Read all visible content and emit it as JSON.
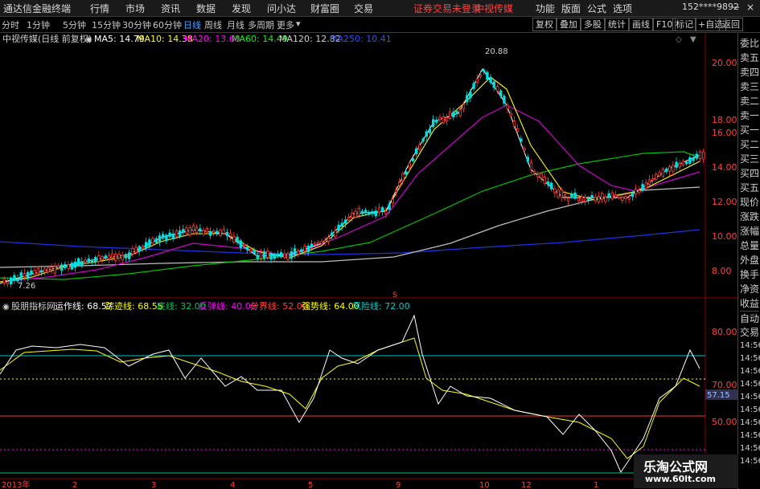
{
  "menu": {
    "app_title": "通达信金融终端",
    "items": [
      "行情",
      "市场",
      "资讯",
      "数据",
      "发现",
      "问小达",
      "财富圈",
      "交易"
    ],
    "notice": "证券交易未登录",
    "stock_name": "中视传媒",
    "right_items": [
      "功能",
      "版面",
      "公式",
      "选项"
    ],
    "account": "152****9892"
  },
  "period_tabs": [
    "分时",
    "1分钟",
    "5分钟",
    "15分钟",
    "30分钟",
    "60分钟",
    "日线",
    "周线",
    "月线",
    "多周期",
    "更多"
  ],
  "active_tab": "日线",
  "toolbar_buttons": [
    "复权",
    "叠加",
    "多股",
    "统计",
    "画线",
    "F10",
    "标记",
    "+自选",
    "返回"
  ],
  "main_chart": {
    "title": "中视传媒(日线 前复权)",
    "ma": [
      {
        "label": "MA5: 14.79",
        "color": "#ffffff"
      },
      {
        "label": "MA10: 14.38",
        "color": "#ffff00"
      },
      {
        "label": "MA20: 13.60",
        "color": "#ff00ff"
      },
      {
        "label": "MA60: 14.49",
        "color": "#00ff00"
      },
      {
        "label": "MA120: 12.82",
        "color": "#c0c0c0"
      },
      {
        "label": "MA250: 10.41",
        "color": "#3050ff"
      }
    ],
    "price_ticks": [
      "20.00",
      "18.00",
      "16.00",
      "14.00",
      "12.00",
      "10.00",
      "8.00"
    ],
    "high_label": "20.88",
    "low_label": "7.26"
  },
  "indicator": {
    "name": "股朋指标网",
    "items": [
      {
        "label": "运作线: 68.57",
        "color": "#ffffff"
      },
      {
        "label": "踪迹线: 68.55",
        "color": "#ffff00"
      },
      {
        "label": "底线: 32.00",
        "color": "#00c060"
      },
      {
        "label": "反弹线: 40.00",
        "color": "#ff00ff"
      },
      {
        "label": "分界线: 52.00",
        "color": "#ff4040"
      },
      {
        "label": "强势线: 64.00",
        "color": "#ffff00"
      },
      {
        "label": "风险线: 72.00",
        "color": "#00c8c8"
      }
    ],
    "ticks": [
      "80.00",
      "70.00",
      "50.00"
    ],
    "current_value": "57.15"
  },
  "time_axis": [
    "2013年",
    "2",
    "3",
    "4",
    "5",
    "9",
    "10",
    "12",
    "1"
  ],
  "right_panel": {
    "top": [
      "委比",
      "卖五",
      "卖四",
      "卖三",
      "卖二",
      "卖一",
      "买一",
      "买二",
      "买三",
      "买四",
      "买五",
      "现价",
      "涨跌",
      "涨幅",
      "总量",
      "外盘",
      "换手",
      "净资",
      "收益"
    ],
    "bottom_header": [
      "自动",
      "交易"
    ],
    "bottom_times": [
      "14:56",
      "14:56",
      "14:56",
      "14:56",
      "14:56",
      "14:56",
      "14:56",
      "14:56",
      "14:56",
      "14:56"
    ]
  },
  "watermark": {
    "title": "乐淘公式网",
    "url": "www.60lt.com"
  }
}
